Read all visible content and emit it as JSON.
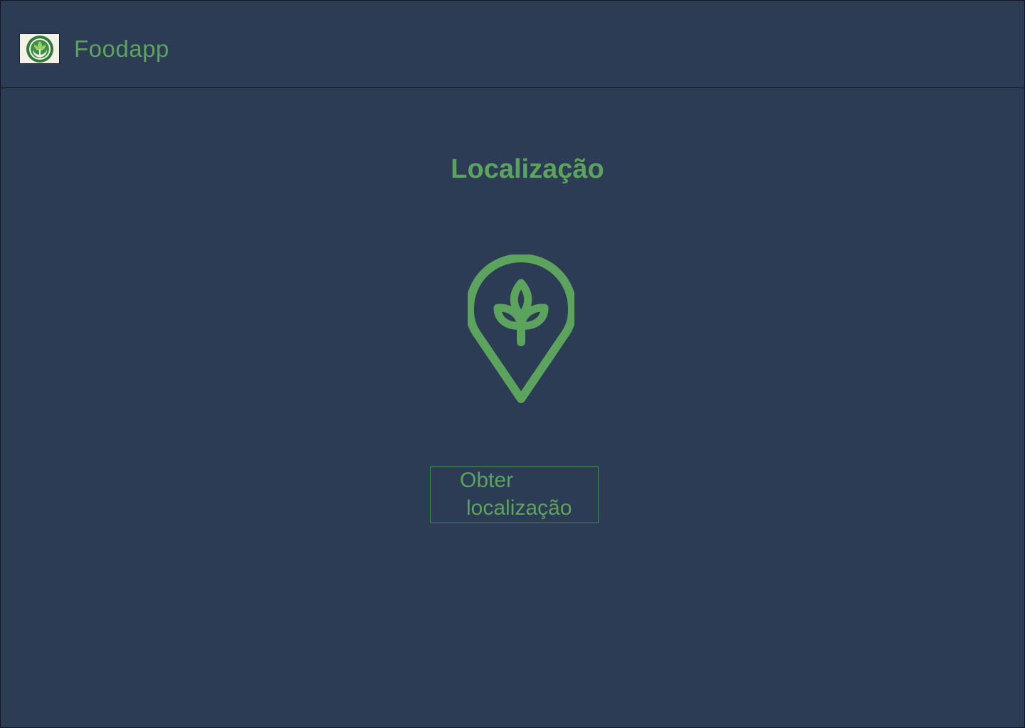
{
  "header": {
    "app_name": "Foodapp",
    "logo_icon": "hands-with-plant-logo-icon"
  },
  "main": {
    "title": "Localização",
    "pin_icon": "location-pin-with-leaf-icon",
    "button": {
      "line1": "Obter",
      "line2": "localização"
    }
  },
  "colors": {
    "background": "#2c3c55",
    "accent_green": "#5ca35d",
    "button_border": "#3e8a4d"
  }
}
